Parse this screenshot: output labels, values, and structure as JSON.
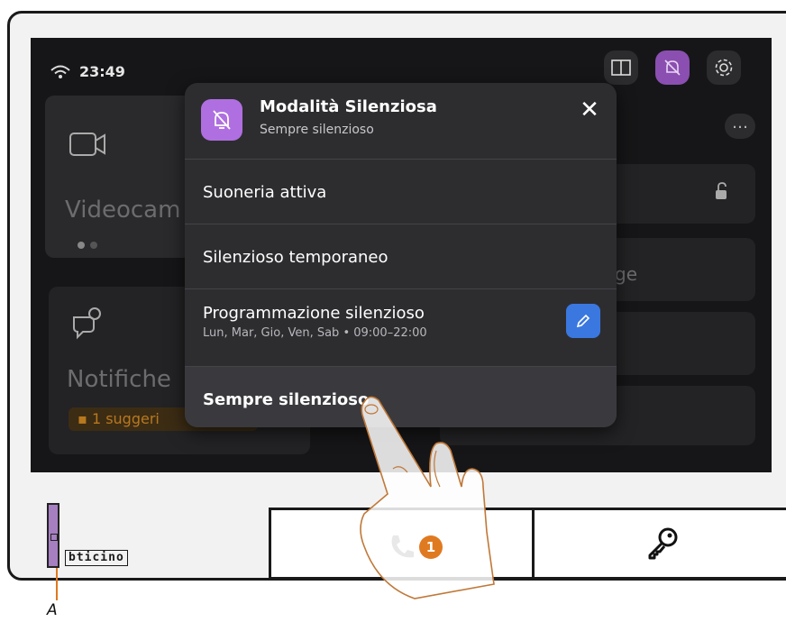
{
  "status": {
    "time": "23:49"
  },
  "background": {
    "video_label": "Videocam",
    "notifications_label": "Notifiche",
    "suggestion_badge": "1 suggeri",
    "partial_text": "ge"
  },
  "menu": {
    "title": "Modalità Silenziosa",
    "subtitle": "Sempre silenzioso",
    "items": [
      {
        "label": "Suoneria attiva",
        "sub": ""
      },
      {
        "label": "Silenzioso temporaneo",
        "sub": ""
      },
      {
        "label": "Programmazione silenzioso",
        "sub": "Lun, Mar, Gio, Ven, Sab • 09:00–22:00"
      },
      {
        "label": "Sempre silenzioso",
        "sub": ""
      }
    ]
  },
  "device": {
    "brand": "bticino",
    "step_number": "1",
    "callout_label": "A"
  },
  "icons": {
    "wifi": "wifi-icon",
    "door": "door-icon",
    "silent": "bell-slash-icon",
    "settings": "gear-icon",
    "close": "close-icon",
    "edit": "pencil-icon",
    "phone": "phone-icon",
    "key": "key-icon"
  },
  "colors": {
    "accent_purple": "#b06fe0",
    "edit_blue": "#3a78e0",
    "badge_orange": "#e07a20"
  }
}
